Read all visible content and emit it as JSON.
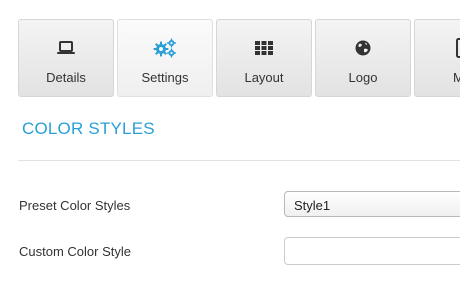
{
  "tabs": [
    {
      "label": "Details",
      "icon": "laptop-icon",
      "active": false
    },
    {
      "label": "Settings",
      "icon": "gears-icon",
      "active": true
    },
    {
      "label": "Layout",
      "icon": "grid-icon",
      "active": false
    },
    {
      "label": "Logo",
      "icon": "globe-icon",
      "active": false
    },
    {
      "label": "Mo",
      "icon": "mobile-icon",
      "active": false
    }
  ],
  "section": {
    "title": "COLOR STYLES"
  },
  "fields": {
    "preset": {
      "label": "Preset Color Styles",
      "value": "Style1"
    },
    "custom": {
      "label": "Custom Color Style",
      "value": ""
    }
  },
  "colors": {
    "accent": "#2a9fd6",
    "icon_dark": "#333333",
    "tab_border": "#d6d6d6"
  }
}
